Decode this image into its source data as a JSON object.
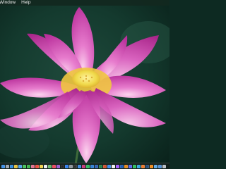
{
  "menubar": {
    "items": [
      {
        "label": "Window"
      },
      {
        "label": "Help"
      }
    ]
  },
  "desktop": {
    "wallpaper_icon": "lotus-flower-icon"
  },
  "dock": {
    "apps": [
      {
        "icon": "finder-icon",
        "color": "#3b8fe8"
      },
      {
        "icon": "launchpad-icon",
        "color": "#9aa3ad"
      },
      {
        "icon": "safari-icon",
        "color": "#2f8be0"
      },
      {
        "icon": "chrome-icon",
        "color": "#e6c23a"
      },
      {
        "icon": "mail-icon",
        "color": "#4aa3f0"
      },
      {
        "icon": "messages-icon",
        "color": "#46c35a"
      },
      {
        "icon": "facetime-icon",
        "color": "#38b44a"
      },
      {
        "icon": "photos-icon",
        "color": "#e36f8e"
      },
      {
        "icon": "calendar-icon",
        "color": "#ef4b3c"
      },
      {
        "icon": "notes-icon",
        "color": "#f2d24a"
      },
      {
        "icon": "reminders-icon",
        "color": "#f0f0f0"
      },
      {
        "icon": "maps-icon",
        "color": "#67b86a"
      },
      {
        "icon": "music-icon",
        "color": "#f0475e"
      },
      {
        "icon": "podcasts-icon",
        "color": "#9b59d0"
      },
      {
        "icon": "tv-icon",
        "color": "#222222"
      },
      {
        "icon": "app-store-icon",
        "color": "#2e7ef0"
      },
      {
        "icon": "preferences-icon",
        "color": "#8e959c"
      },
      {
        "icon": "terminal-icon",
        "color": "#303030"
      },
      {
        "icon": "xcode-icon",
        "color": "#3a86e0"
      },
      {
        "icon": "slack-icon",
        "color": "#c9357a"
      },
      {
        "icon": "spotify-icon",
        "color": "#2bbd5c"
      },
      {
        "icon": "vscode-icon",
        "color": "#2d7fd6"
      },
      {
        "icon": "word-icon",
        "color": "#2b5fb4"
      },
      {
        "icon": "excel-icon",
        "color": "#22834a"
      },
      {
        "icon": "powerpoint-icon",
        "color": "#d1512d"
      },
      {
        "icon": "zoom-icon",
        "color": "#3a8af0"
      },
      {
        "icon": "notion-icon",
        "color": "#f3f3f3"
      },
      {
        "icon": "figma-icon",
        "color": "#a259ff"
      },
      {
        "icon": "photoshop-icon",
        "color": "#1d5bb5"
      },
      {
        "icon": "illustrator-icon",
        "color": "#e88a1a"
      },
      {
        "icon": "discord-icon",
        "color": "#5865f2"
      },
      {
        "icon": "whatsapp-icon",
        "color": "#2cc05a"
      },
      {
        "icon": "telegram-icon",
        "color": "#2ea6e0"
      },
      {
        "icon": "firefox-icon",
        "color": "#ef7a2a"
      },
      {
        "icon": "steam-icon",
        "color": "#244c7a"
      },
      {
        "icon": "vlc-icon",
        "color": "#f08a1a"
      },
      {
        "icon": "folder-icon",
        "color": "#5aa7e8"
      },
      {
        "icon": "downloads-icon",
        "color": "#4f8fd8"
      },
      {
        "icon": "trash-icon",
        "color": "#b9bec4"
      }
    ]
  }
}
